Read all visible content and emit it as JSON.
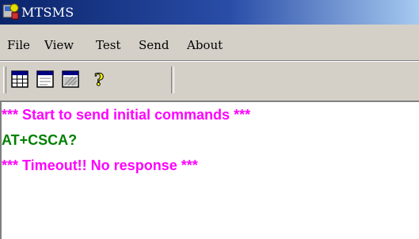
{
  "window": {
    "title": "MTSMS"
  },
  "menu": [
    "File",
    "View",
    "Test",
    "Send",
    "About"
  ],
  "toolbar": {
    "buttons": [
      {
        "icon": "table-grid-icon"
      },
      {
        "icon": "window-icon"
      },
      {
        "icon": "hatched-window-icon"
      },
      {
        "icon": "help-question-icon"
      }
    ]
  },
  "colors": {
    "status": "#ff00ff",
    "command": "#008000"
  },
  "log": [
    {
      "text": "*** Start to send initial commands ***",
      "kind": "status"
    },
    {
      "text": "AT+CSCA?",
      "kind": "command"
    },
    {
      "text": "*** Timeout!! No response ***",
      "kind": "status"
    }
  ]
}
